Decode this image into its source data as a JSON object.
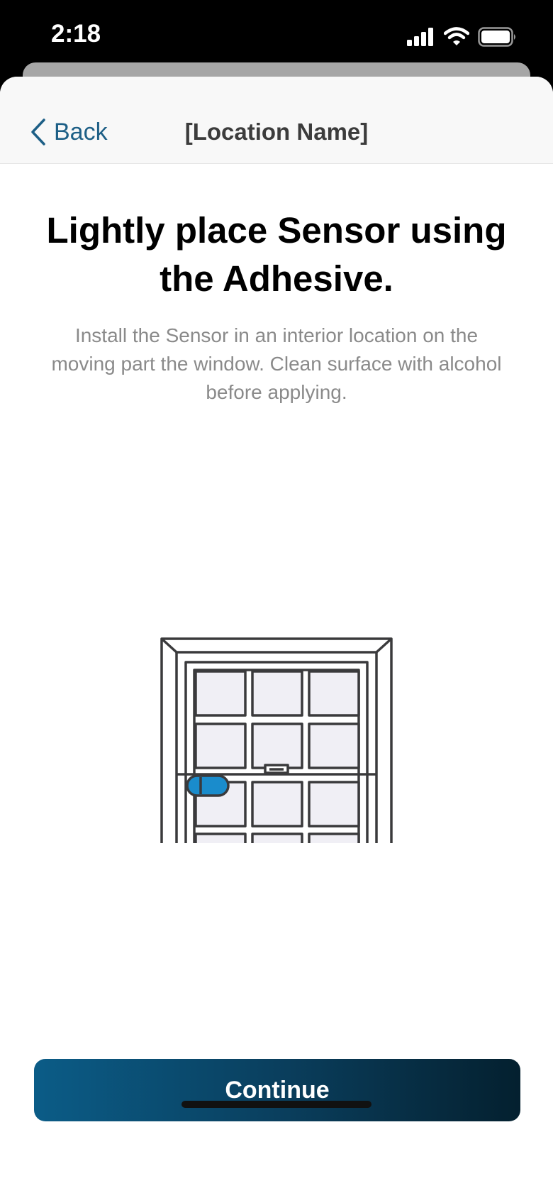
{
  "status_bar": {
    "time": "2:18",
    "icons": [
      "cellular-signal-icon",
      "wifi-icon",
      "battery-icon"
    ]
  },
  "nav": {
    "back_label": "Back",
    "back_icon": "chevron-left-icon",
    "title": "[Location Name]"
  },
  "content": {
    "heading": "Lightly place Sensor using the Adhesive.",
    "description": "Install the Sensor in an interior location on the moving part the window. Clean surface with alcohol before applying.",
    "illustration": "window-sensor-illustration"
  },
  "footer": {
    "continue_label": "Continue"
  },
  "colors": {
    "accent": "#1d5f86",
    "sensor": "#1a8ccc",
    "button_gradient_start": "#0b5c87",
    "button_gradient_end": "#04202f",
    "pane_fill": "#f0eff5",
    "frame_stroke": "#3a3a3c"
  }
}
